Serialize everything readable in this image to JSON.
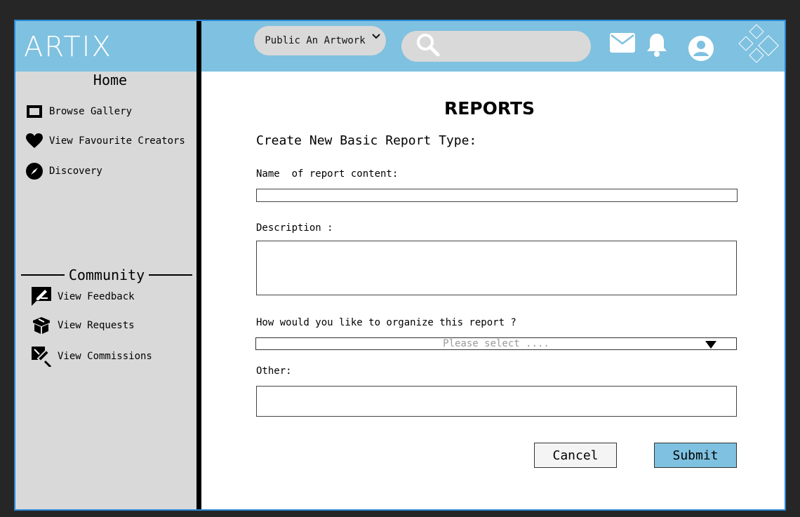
{
  "app": {
    "logo": "ARTIX"
  },
  "header": {
    "publish_label": "Public An Artwork",
    "search_placeholder": "",
    "icons": [
      "chevron-down-icon",
      "search-icon",
      "mail-icon",
      "bell-icon",
      "user-avatar-icon",
      "diamond-logo-icon"
    ]
  },
  "sidebar": {
    "home": "Home",
    "items": [
      {
        "label": "Browse Gallery",
        "icon": "gallery-icon"
      },
      {
        "label": "View Favourite Creators",
        "icon": "heart-icon"
      },
      {
        "label": "Discovery",
        "icon": "compass-icon"
      }
    ],
    "community_heading": "Community",
    "community_items": [
      {
        "label": "View Feedback",
        "icon": "feedback-icon"
      },
      {
        "label": "View Requests",
        "icon": "box-icon"
      },
      {
        "label": "View Commissions",
        "icon": "commission-icon"
      }
    ]
  },
  "main": {
    "title": "REPORTS",
    "form_heading": "Create New Basic Report Type:",
    "name_label": "Name  of report content:",
    "description_label": "Description :",
    "organize_label": "How would you like to organize this report ?",
    "select_placeholder": "Please select ....",
    "other_label": "Other:",
    "cancel_label": "Cancel",
    "submit_label": "Submit"
  },
  "colors": {
    "header_bg": "#7fc1e0",
    "sidebar_bg": "#d9d9d9",
    "frame_border": "#2a86d6",
    "submit_bg": "#7fc1e0",
    "page_bg": "#262626"
  }
}
